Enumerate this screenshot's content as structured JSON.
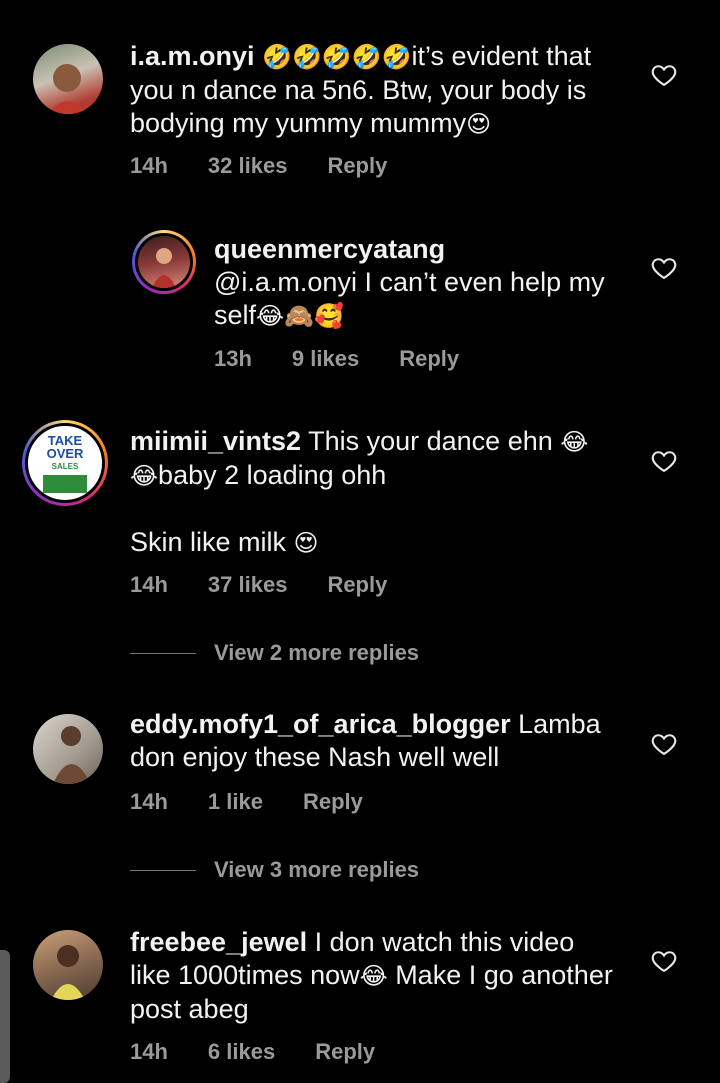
{
  "comments": [
    {
      "username": "i.a.m.onyi",
      "emojis": "🤣🤣🤣🤣🤣",
      "text": "it’s evident that you n dance na 5n6. Btw, your body is bodying my yummy mummy",
      "trailing_emoji": "😍",
      "time": "14h",
      "likes": "32 likes",
      "reply": "Reply"
    },
    {
      "username": "queenmercyatang",
      "text": "@i.a.m.onyi I can’t even help my self",
      "trailing_emoji": "😂🙈🥰",
      "time": "13h",
      "likes": "9 likes",
      "reply": "Reply"
    },
    {
      "username": "miimii_vints2",
      "text": "This your dance ehn",
      "emoji_a": "😂",
      "text2": "baby 2 loading ohh",
      "text3": "Skin like milk",
      "emoji_b": "😍",
      "time": "14h",
      "likes": "37 likes",
      "reply": "Reply",
      "avatar_text": [
        "TAKE",
        "OVER",
        "SALES"
      ]
    },
    {
      "username": "eddy.mofy1_of_arica_blogger",
      "text": "Lamba don enjoy these Nash well well",
      "time": "14h",
      "likes": "1 like",
      "reply": "Reply"
    },
    {
      "username": "freebee_jewel",
      "text": "I don watch this video like 1000times now",
      "emoji": "😂",
      "text2": "Make I go another post abeg",
      "time": "14h",
      "likes": "6 likes",
      "reply": "Reply"
    }
  ],
  "view_more": [
    "View 2 more replies",
    "View 3 more replies"
  ]
}
